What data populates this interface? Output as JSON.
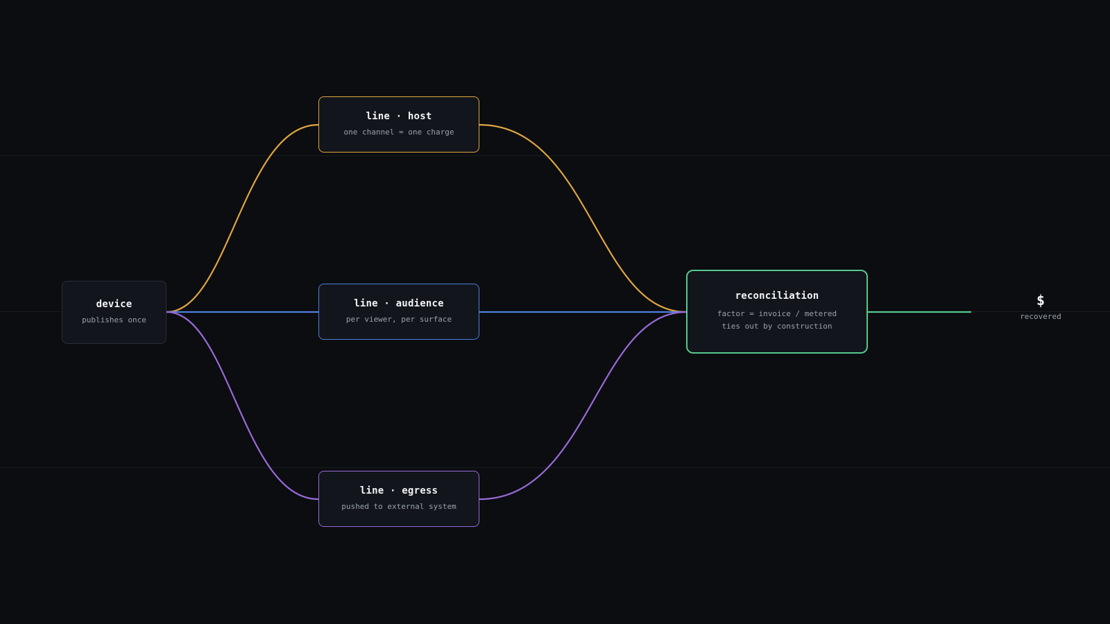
{
  "colors": {
    "background": "#0b0d11",
    "host": "#e0a53f",
    "audience": "#4f7fdd",
    "egress": "#9a6ad8",
    "reconciliation": "#56c98d",
    "device_border": "#2a2e36"
  },
  "nodes": {
    "device": {
      "title": "device",
      "subtitle": "publishes once"
    },
    "host": {
      "title": "line · host",
      "subtitle": "one channel = one charge"
    },
    "audience": {
      "title": "line · audience",
      "subtitle": "per viewer, per surface"
    },
    "egress": {
      "title": "line · egress",
      "subtitle": "pushed to external system"
    },
    "reconciliation": {
      "title": "reconciliation",
      "line1": "factor = invoice / metered",
      "line2": "ties out by construction"
    }
  },
  "result": {
    "symbol": "$",
    "label": "recovered"
  }
}
